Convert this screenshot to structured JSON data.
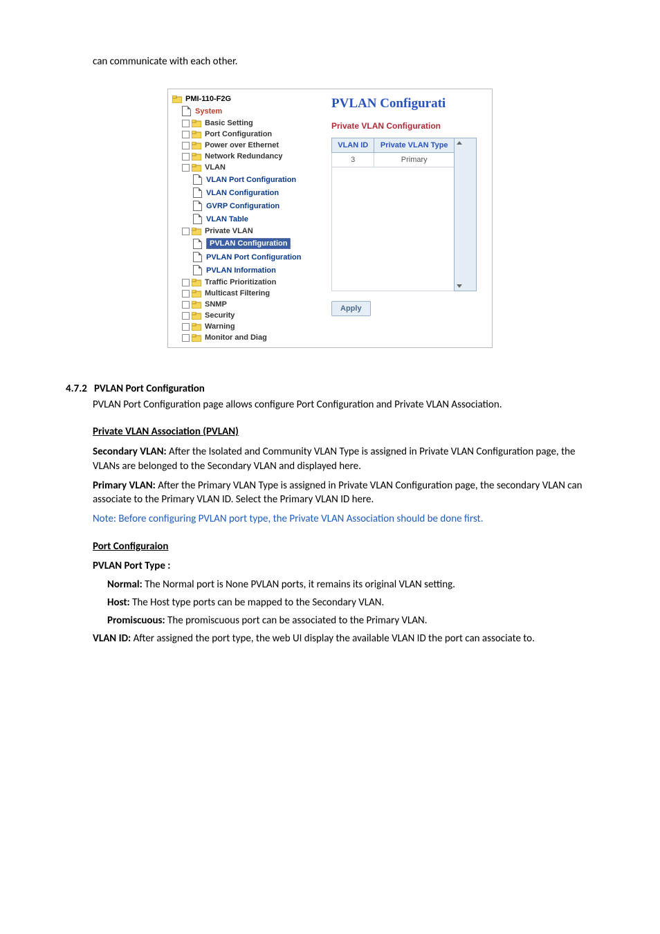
{
  "top_text": "can communicate with each other.",
  "tree": {
    "root": "PMI-110-F2G",
    "system": "System",
    "basic_setting": "Basic Setting",
    "port_config": "Port Configuration",
    "poe": "Power over Ethernet",
    "net_redundancy": "Network Redundancy",
    "vlan": "VLAN",
    "vlan_port_config": "VLAN Port Configuration",
    "vlan_config": "VLAN Configuration",
    "gvrp_config": "GVRP Configuration",
    "vlan_table": "VLAN Table",
    "private_vlan": "Private VLAN",
    "pvlan_config": "PVLAN Configuration",
    "pvlan_port_config": "PVLAN Port Configuration",
    "pvlan_info": "PVLAN Information",
    "traffic_pri": "Traffic Prioritization",
    "multicast": "Multicast Filtering",
    "snmp": "SNMP",
    "security": "Security",
    "warning": "Warning",
    "monitor": "Monitor and Diag"
  },
  "panel": {
    "title": "PVLAN Configurati",
    "subtitle": "Private VLAN Configuration",
    "th_vlanid": "VLAN ID",
    "th_type": "Private VLAN Type",
    "row_vlanid": "3",
    "row_type": "Primary",
    "apply": "Apply"
  },
  "section_472": {
    "num": "4.7.2",
    "title": "PVLAN Port Configuration",
    "intro": "PVLAN Port Configuration page allows configure Port Configuration and Private VLAN Association."
  },
  "pvlan_assoc": {
    "heading": "Private VLAN Association (PVLAN)",
    "secondary_label": "Secondary VLAN:",
    "secondary_text": " After the Isolated and Community VLAN Type is assigned in Private VLAN Configuration page, the VLANs are belonged to the Secondary VLAN and displayed here.",
    "primary_label": "Primary VLAN:",
    "primary_text": " After the Primary VLAN Type is assigned in Private VLAN Configuration page, the secondary VLAN can associate to the Primary VLAN ID. Select the Primary VLAN ID here.",
    "note": "Note: Before configuring PVLAN port type, the Private VLAN Association should be done first."
  },
  "port_conf": {
    "heading": "Port Configuraion",
    "porttype_heading": "PVLAN Port Type :",
    "normal_label": "Normal:",
    "normal_text": " The Normal port is None PVLAN ports, it remains its original VLAN setting.",
    "host_label": "Host:",
    "host_text": " The Host type ports can be mapped to the Secondary VLAN.",
    "promisc_label": "Promiscuous:",
    "promisc_text": " The promiscuous port can be associated to the Primary VLAN.",
    "vlanid_label": "VLAN ID:",
    "vlanid_text": " After assigned the port type, the web UI display the available VLAN ID the port can associate to."
  }
}
